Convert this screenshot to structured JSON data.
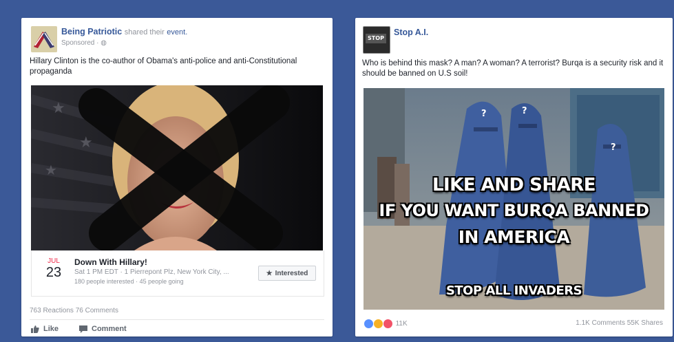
{
  "post1": {
    "page_name": "Being Patriotic",
    "action_text": "shared their",
    "action_link": "event.",
    "sponsored": "Sponsored · ◍",
    "text": "Hillary Clinton is the co-author of Obama's anti-police and anti-Constitutional propaganda",
    "event": {
      "month": "JUL",
      "day": "23",
      "title": "Down With Hillary!",
      "details": "Sat 1 PM EDT · 1 Pierrepont Plz, New York City, ...",
      "stats": "180 people interested · 45 people going",
      "interested_label": "Interested"
    },
    "reactions": "763 Reactions",
    "comments": "76 Comments",
    "like_label": "Like",
    "comment_label": "Comment"
  },
  "post2": {
    "page_name": "Stop A.I.",
    "avatar_text": "STOP",
    "text": "Who is behind this mask? A man? A woman? A terrorist? Burqa is a security risk and it should be banned on U.S soil!",
    "meme_lines": [
      "LIKE AND SHARE",
      "IF YOU WANT BURQA BANNED",
      "IN AMERICA"
    ],
    "meme_bottom": "STOP ALL INVADERS",
    "reaction_count": "11K",
    "comments": "1.1K Comments",
    "shares": "55K Shares"
  },
  "colors": {
    "background": "#3b5998",
    "link": "#365899",
    "muted": "#90949c",
    "burqa": "#3f5f9f",
    "event_month": "#f02849"
  }
}
